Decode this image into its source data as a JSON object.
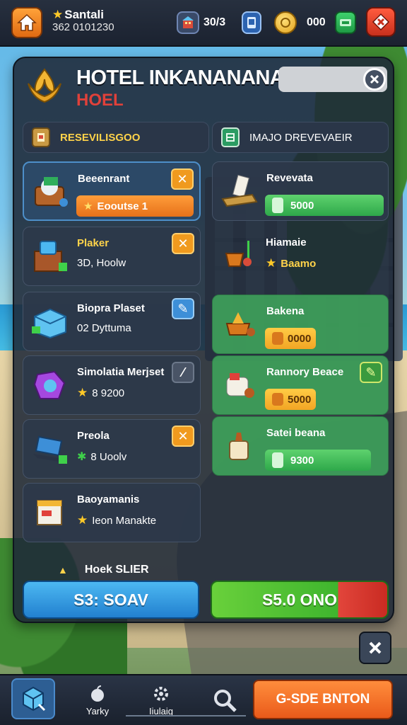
{
  "hud": {
    "player_name": "Santali",
    "player_id": "362 0101230",
    "resource_1": "30/3",
    "resource_3": "000"
  },
  "panel": {
    "title": "HOTEL INKANANANASIA",
    "subtitle": "HOEL",
    "tabs": [
      {
        "label": "RESEVILISGOO"
      },
      {
        "label": "IMAJO DREVEVAEIR"
      }
    ],
    "left_items": [
      {
        "name": "Beeenrant",
        "value": "Eooutse 1",
        "style": "price-orange"
      },
      {
        "name": "Plaker",
        "value": "3D, Hoolw"
      },
      {
        "name": "Biopra Plaset",
        "value": "02 Dyttuma"
      },
      {
        "name": "Simolatia Merjset",
        "value": "8 9200"
      },
      {
        "name": "Preola",
        "value": "8 Uoolv"
      },
      {
        "name": "Baoyamanis",
        "value": "Ieon Manakte"
      }
    ],
    "right_items": [
      {
        "name": "Revevata",
        "value": "5000"
      },
      {
        "name": "Hiamaie",
        "value": "Baamo"
      },
      {
        "name": "Bakena",
        "value": "0000"
      },
      {
        "name": "Rannory Beace",
        "value": "5000"
      },
      {
        "name": "Satei beana",
        "value": "9300"
      }
    ],
    "footer_label": "Hoek SLIER",
    "btn_left": "S3: SOAV",
    "btn_right": "S5.0 ONO"
  },
  "bottom_nav": {
    "items": [
      {
        "label": "Yarky"
      },
      {
        "label": "Iiulaig"
      }
    ],
    "cta": "G-SDE BNTON"
  },
  "colors": {
    "panel_bg": "#1f2938",
    "accent_orange": "#f09a1e",
    "accent_green": "#3fb52e",
    "accent_blue": "#2280cf"
  },
  "icons": [
    "home-icon",
    "star-icon",
    "hotel-icon",
    "tablet-icon",
    "coin-icon",
    "cash-icon",
    "settings-icon",
    "emblem-icon",
    "close-icon",
    "search-icon",
    "apple-icon",
    "scroll-icon"
  ]
}
